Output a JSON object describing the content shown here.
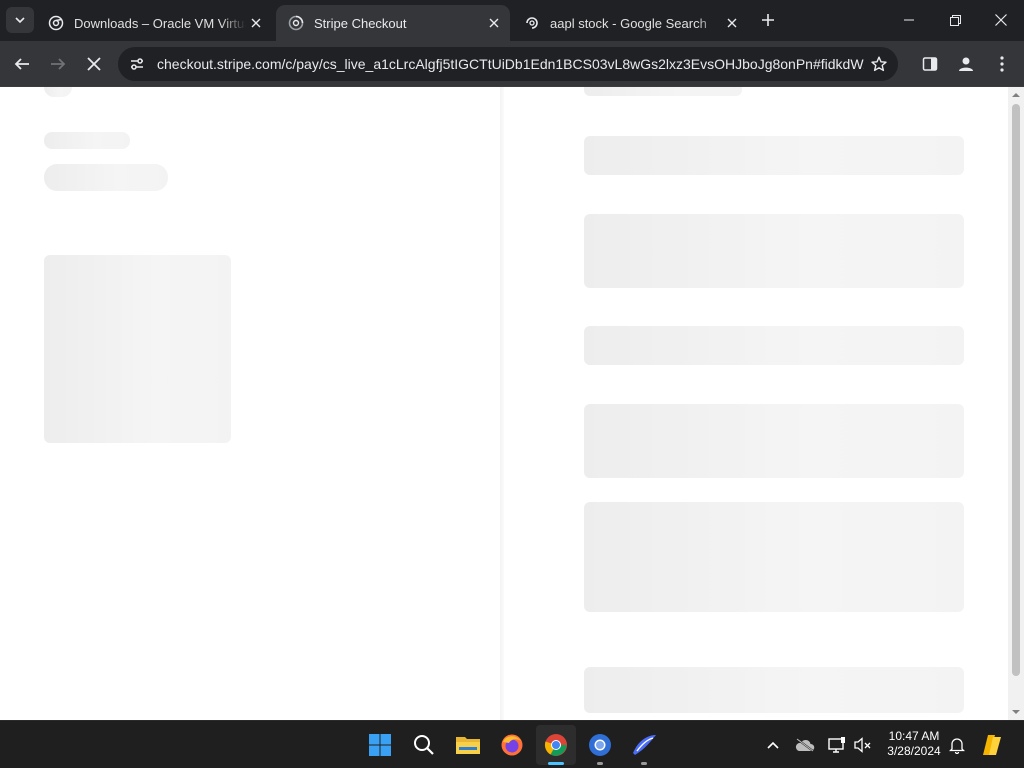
{
  "browser": {
    "tabs": [
      {
        "title": "Downloads – Oracle VM VirtualBox",
        "favicon": "chromium-icon",
        "active": false
      },
      {
        "title": "Stripe Checkout",
        "favicon": "stripe-loading-icon",
        "active": true
      },
      {
        "title": "aapl stock - Google Search",
        "favicon": "google-loading-icon",
        "active": false
      }
    ],
    "address_bar": {
      "url": "checkout.stripe.com/c/pay/cs_live_a1cLrcAlgfj5tIGCTtUiDb1Edn1BCS03vL8wGs2lxz3EvsOHJboJg8onPn#fidkdWxO..."
    },
    "loading": true
  },
  "page": {
    "state": "loading-skeleton"
  },
  "taskbar": {
    "apps": [
      {
        "name": "start-icon"
      },
      {
        "name": "search-icon"
      },
      {
        "name": "file-explorer-icon"
      },
      {
        "name": "firefox-icon"
      },
      {
        "name": "chrome-icon",
        "active": true
      },
      {
        "name": "chromium-icon",
        "open": true
      },
      {
        "name": "pen-app-icon",
        "open": true
      }
    ],
    "clock": {
      "time": "10:47 AM",
      "date": "3/28/2024"
    }
  },
  "colors": {
    "tab_strip": "#202124",
    "toolbar": "#35363a",
    "omnibox": "#202124",
    "skeleton": "#efefef",
    "taskbar": "#1f1f1f",
    "accent": "#4cc2ff"
  }
}
